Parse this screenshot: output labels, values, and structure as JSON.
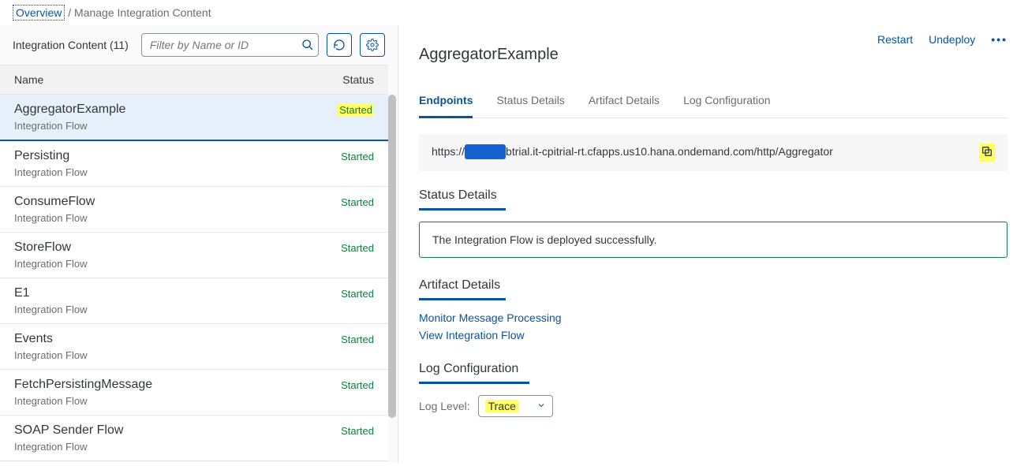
{
  "breadcrumb": {
    "link": "Overview",
    "current": "Manage Integration Content"
  },
  "leftTitle": "Integration Content (11)",
  "searchPlaceholder": "Filter by Name or ID",
  "tableHead": {
    "name": "Name",
    "status": "Status"
  },
  "rows": [
    {
      "name": "AggregatorExample",
      "type": "Integration Flow",
      "status": "Started",
      "selected": true,
      "highlight": true
    },
    {
      "name": "Persisting",
      "type": "Integration Flow",
      "status": "Started"
    },
    {
      "name": "ConsumeFlow",
      "type": "Integration Flow",
      "status": "Started"
    },
    {
      "name": "StoreFlow",
      "type": "Integration Flow",
      "status": "Started"
    },
    {
      "name": "E1",
      "type": "Integration Flow",
      "status": "Started"
    },
    {
      "name": "Events",
      "type": "Integration Flow",
      "status": "Started"
    },
    {
      "name": "FetchPersistingMessage",
      "type": "Integration Flow",
      "status": "Started"
    },
    {
      "name": "SOAP Sender Flow",
      "type": "Integration Flow",
      "status": "Started"
    }
  ],
  "detail": {
    "title": "AggregatorExample",
    "restart": "Restart",
    "undeploy": "Undeploy"
  },
  "tabs": [
    "Endpoints",
    "Status Details",
    "Artifact Details",
    "Log Configuration"
  ],
  "endpointPrefix": "https://",
  "endpointMid": "btrial.it-cpitrial-rt.cfapps.us10.hana.ondemand.com/http/Aggregator",
  "sections": {
    "statusTitle": "Status Details",
    "statusMsg": "The Integration Flow is deployed successfully.",
    "artifactTitle": "Artifact Details",
    "link1": "Monitor Message Processing",
    "link2": "View Integration Flow",
    "logTitle": "Log Configuration",
    "logLabel": "Log Level:",
    "logValue": "Trace"
  }
}
